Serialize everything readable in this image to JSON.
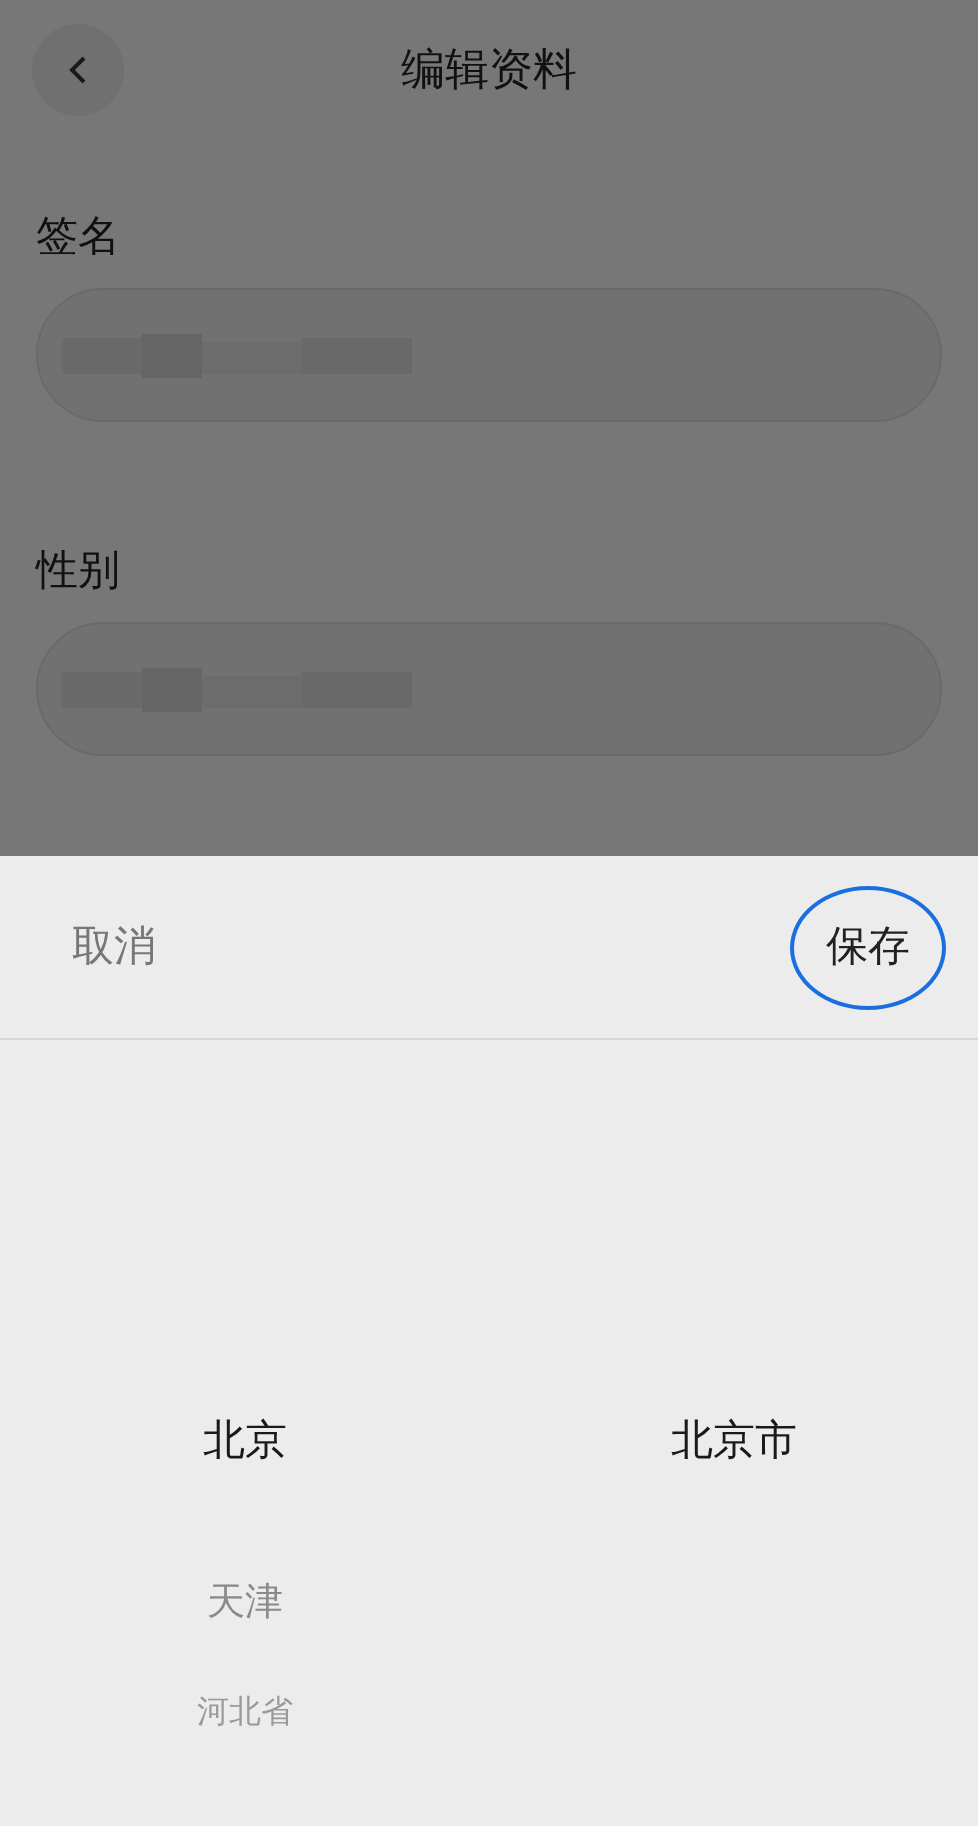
{
  "header": {
    "title": "编辑资料"
  },
  "fields": [
    {
      "label": "签名",
      "value_hidden": true
    },
    {
      "label": "性别",
      "value_hidden": true
    }
  ],
  "sheet": {
    "cancel": "取消",
    "save": {
      "label": "保存",
      "highlighted": true
    }
  },
  "picker": {
    "columns": [
      {
        "items": [
          {
            "label": "北京",
            "selected": true
          },
          {
            "label": "天津",
            "selected": false
          },
          {
            "label": "河北省",
            "selected": false
          }
        ]
      },
      {
        "items": [
          {
            "label": "北京市",
            "selected": true
          }
        ]
      }
    ]
  }
}
